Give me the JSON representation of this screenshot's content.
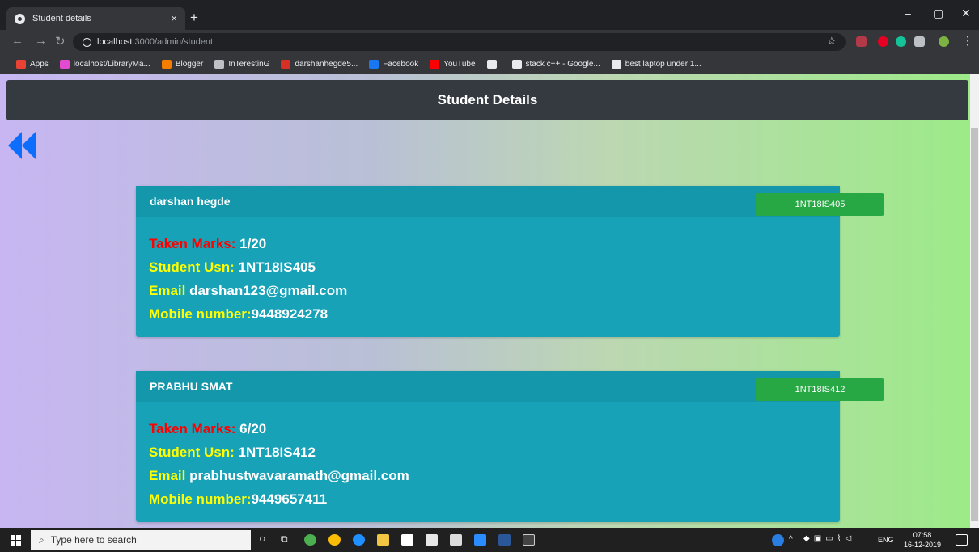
{
  "browser": {
    "tab_title": "Student details",
    "tab_close": "×",
    "new_tab": "+",
    "url_host": "localhost",
    "url_path": ":3000/admin/student",
    "window_minimize": "–",
    "window_maximize": "▢",
    "window_close": "✕",
    "bookmarks": [
      {
        "label": "Apps",
        "color": "#ea4335"
      },
      {
        "label": "localhost/LibraryMa...",
        "color": "#e24bd0"
      },
      {
        "label": "Blogger",
        "color": "#f57d00"
      },
      {
        "label": "InTerestinG",
        "color": "#bdc1c6"
      },
      {
        "label": "darshanhegde5...",
        "color": "#d93025"
      },
      {
        "label": "Facebook",
        "color": "#1877f2"
      },
      {
        "label": "YouTube",
        "color": "#ff0000"
      },
      {
        "label": "",
        "color": "#e8eaed"
      },
      {
        "label": "stack c++ - Google...",
        "color": "#e8eaed"
      },
      {
        "label": "best laptop under 1...",
        "color": "#e8eaed"
      }
    ]
  },
  "page": {
    "title": "Student Details",
    "students": [
      {
        "name": "darshan hegde",
        "usn_badge": "1NT18IS405",
        "marks_label": "Taken Marks:",
        "marks_value": "1/20",
        "usn_label": "Student Usn:",
        "usn_value": "1NT18IS405",
        "email_label": "Email",
        "email_value": "darshan123@gmail.com",
        "mobile_label": "Mobile number:",
        "mobile_value": "9448924278"
      },
      {
        "name": "PRABHU SMAT",
        "usn_badge": "1NT18IS412",
        "marks_label": "Taken Marks:",
        "marks_value": "6/20",
        "usn_label": "Student Usn:",
        "usn_value": "1NT18IS412",
        "email_label": "Email",
        "email_value": "prabhustwavaramath@gmail.com",
        "mobile_label": "Mobile number:",
        "mobile_value": "9449657411"
      }
    ],
    "colors": {
      "card": "#17a2b8",
      "badge": "#28a745",
      "navbar": "#343a40",
      "label_red": "#ff0000",
      "label_yellow": "#ffff00"
    }
  },
  "taskbar": {
    "search_placeholder": "Type here to search",
    "language": "ENG",
    "time": "07:58",
    "date": "16-12-2019"
  }
}
